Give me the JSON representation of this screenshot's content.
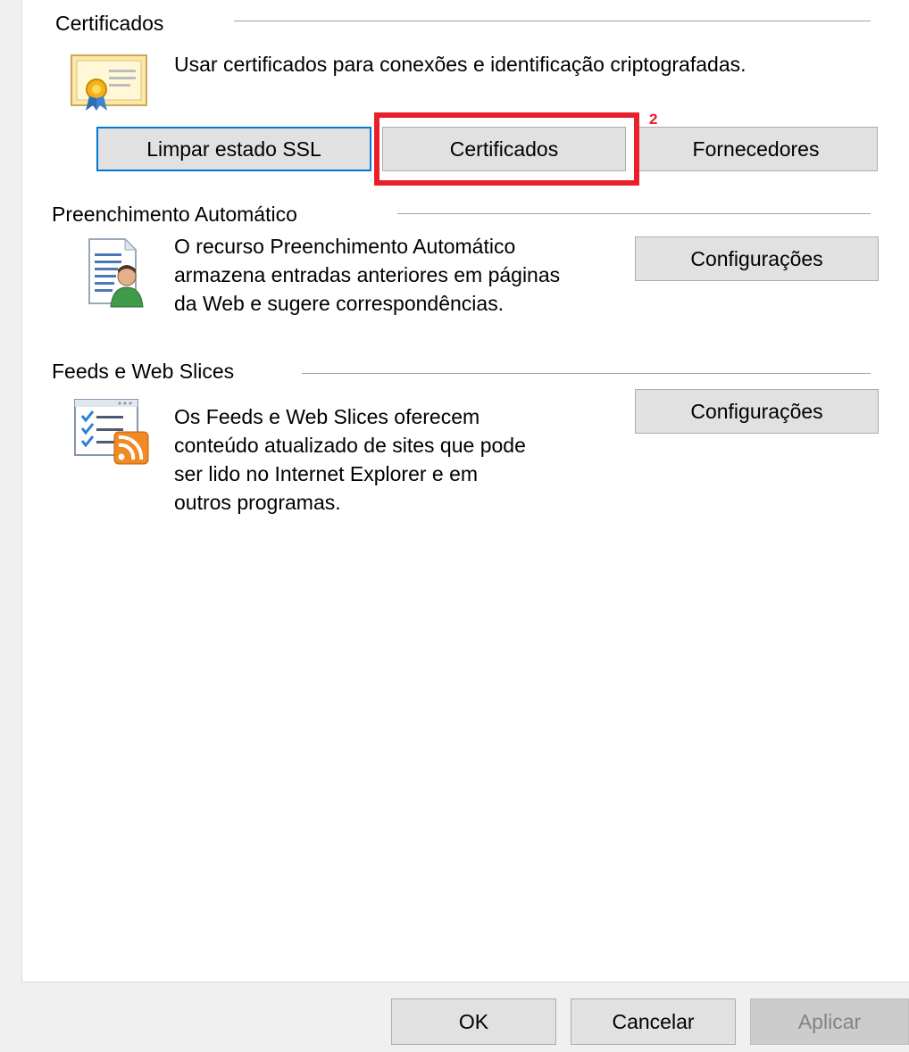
{
  "certificates": {
    "group_title": "Certificados",
    "description": "Usar certificados para conexões e identificação criptografadas.",
    "icon": "certificate-icon",
    "buttons": {
      "clear_ssl": "Limpar estado SSL",
      "certificates": "Certificados",
      "publishers": "Fornecedores"
    }
  },
  "annotation": {
    "step_number": "2",
    "color": "#e8202a"
  },
  "autocomplete": {
    "group_title": "Preenchimento Automático",
    "description_lines": [
      "O recurso Preenchimento Automático",
      "armazena entradas anteriores em páginas",
      "da Web e sugere correspondências."
    ],
    "icon": "autocomplete-user-icon",
    "settings_button": "Configurações"
  },
  "feeds": {
    "group_title": "Feeds e Web Slices",
    "description_lines": [
      "Os Feeds e Web Slices oferecem",
      "conteúdo atualizado de sites que pode",
      "ser lido no Internet Explorer e em",
      "outros programas."
    ],
    "icon": "feeds-rss-icon",
    "settings_button": "Configurações"
  },
  "dialog_buttons": {
    "ok": "OK",
    "cancel": "Cancelar",
    "apply": "Aplicar"
  },
  "colors": {
    "focus_border": "#0078d7",
    "highlight": "#e8202a"
  }
}
